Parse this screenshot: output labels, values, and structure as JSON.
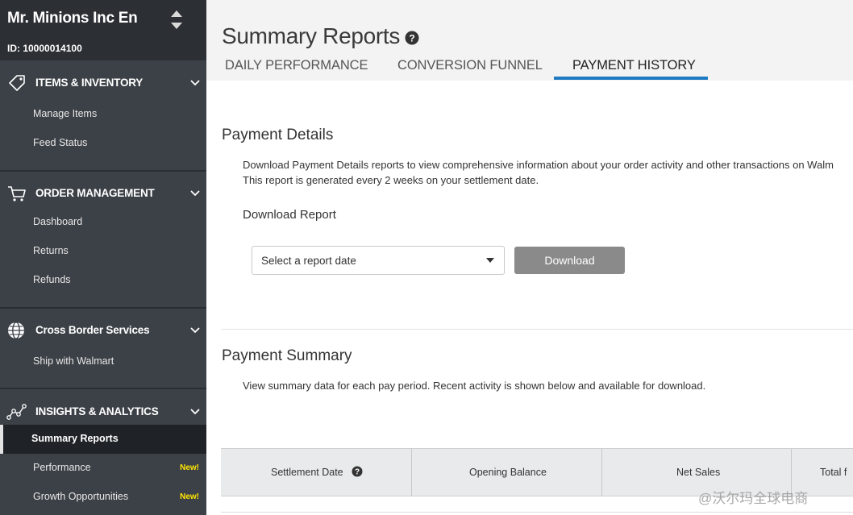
{
  "brand": {
    "name": "Mr. Minions Inc En",
    "id_label": "ID: 10000014100"
  },
  "sidebar": {
    "sections": [
      {
        "title": "ITEMS & INVENTORY",
        "icon": "tag-icon",
        "items": [
          {
            "label": "Manage Items"
          },
          {
            "label": "Feed Status"
          }
        ]
      },
      {
        "title": "ORDER MANAGEMENT",
        "icon": "cart-icon",
        "items": [
          {
            "label": "Dashboard"
          },
          {
            "label": "Returns"
          },
          {
            "label": "Refunds"
          }
        ]
      },
      {
        "title": "Cross Border Services",
        "icon": "globe-icon",
        "items": [
          {
            "label": "Ship with Walmart"
          }
        ]
      },
      {
        "title": "INSIGHTS & ANALYTICS",
        "icon": "analytics-icon",
        "items": [
          {
            "label": "Summary Reports",
            "active": true
          },
          {
            "label": "Performance",
            "badge": "New!"
          },
          {
            "label": "Growth Opportunities",
            "badge": "New!"
          }
        ]
      }
    ]
  },
  "header": {
    "title": "Summary Reports",
    "tabs": [
      {
        "label": "DAILY PERFORMANCE"
      },
      {
        "label": "CONVERSION FUNNEL"
      },
      {
        "label": "PAYMENT HISTORY",
        "active": true
      }
    ]
  },
  "payment_details": {
    "title": "Payment Details",
    "line1": "Download Payment Details reports to view comprehensive information about your order activity and other transactions on Walm",
    "line2": "This report is generated every 2 weeks on your settlement date.",
    "download_label": "Download Report",
    "select_placeholder": "Select a report date",
    "download_button": "Download"
  },
  "payment_summary": {
    "title": "Payment Summary",
    "description": "View summary data for each pay period. Recent activity is shown below and available for download.",
    "columns": [
      "Settlement Date",
      "Opening Balance",
      "Net Sales",
      "Total f"
    ]
  },
  "watermark": "@沃尔玛全球电商",
  "colors": {
    "sidebar": "#3c4147",
    "brand_bg": "#2c3035",
    "accent": "#1f7bc1",
    "badge": "#ffe500",
    "button": "#8a8a8a"
  }
}
